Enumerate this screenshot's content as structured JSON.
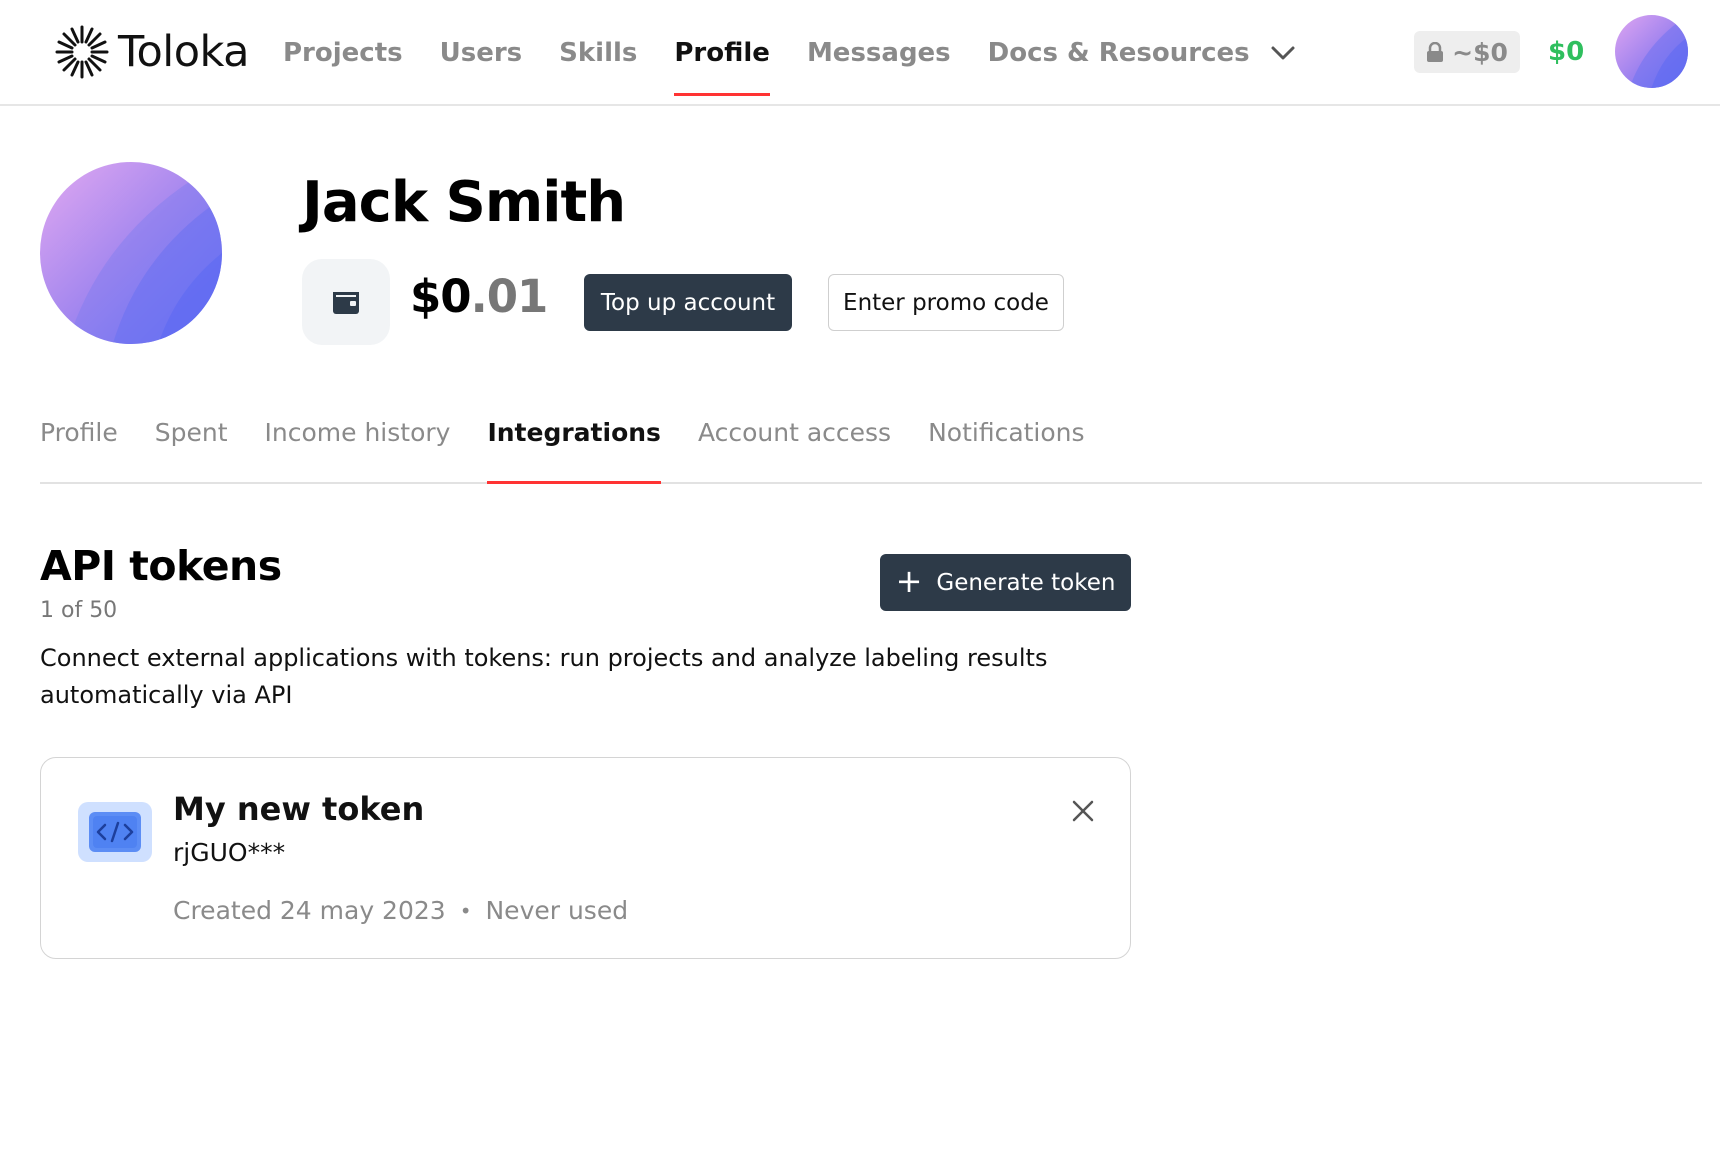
{
  "header": {
    "logo_text": "Toloka",
    "nav": [
      {
        "label": "Projects",
        "active": false
      },
      {
        "label": "Users",
        "active": false
      },
      {
        "label": "Skills",
        "active": false
      },
      {
        "label": "Profile",
        "active": true
      },
      {
        "label": "Messages",
        "active": false
      },
      {
        "label": "Docs & Resources",
        "active": false
      }
    ],
    "locked_balance": "~$0",
    "balance": "$0"
  },
  "profile": {
    "name": "Jack Smith",
    "balance_int": "$0",
    "balance_dec": ".01",
    "topup_label": "Top up account",
    "promo_label": "Enter promo code"
  },
  "tabs": [
    {
      "label": "Profile",
      "active": false
    },
    {
      "label": "Spent",
      "active": false
    },
    {
      "label": "Income history",
      "active": false
    },
    {
      "label": "Integrations",
      "active": true
    },
    {
      "label": "Account access",
      "active": false
    },
    {
      "label": "Notifications",
      "active": false
    }
  ],
  "api": {
    "title": "API tokens",
    "count": "1 of 50",
    "description": "Connect external applications with tokens: run projects and analyze labeling results automatically via API",
    "generate_label": "Generate token",
    "tokens": [
      {
        "name": "My new token",
        "value": "rjGUO***",
        "created": "Created 24 may 2023",
        "separator": "•",
        "usage": "Never used"
      }
    ]
  },
  "colors": {
    "accent_red": "#ff3333",
    "dark_button": "#2d3a48",
    "balance_green": "#2fbf5e"
  }
}
